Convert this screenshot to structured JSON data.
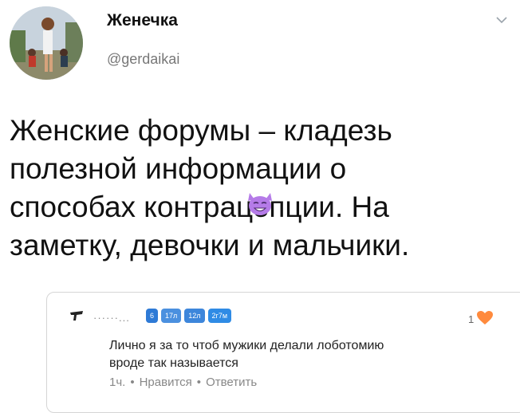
{
  "tweet": {
    "display_name": "Женечка",
    "handle": "@gerdaikai",
    "lines": [
      "Женские форумы – кладезь",
      "полезной информации о",
      "способах контрацепции. На",
      "заметку, девочки и мальчики."
    ]
  },
  "comment": {
    "author": "······...",
    "badges": [
      "6",
      "17л",
      "12л",
      "2г7м"
    ],
    "like_count": "1",
    "lines": [
      "Лично я за то чтоб мужики делали лоботомию",
      "вроде так называется"
    ],
    "time": "1ч.",
    "like_action": "Нравится",
    "reply_action": "Ответить"
  },
  "colors": {
    "heart": "#ff8a3d",
    "badge": "#2f8be5",
    "emoji": "#b57be8"
  }
}
